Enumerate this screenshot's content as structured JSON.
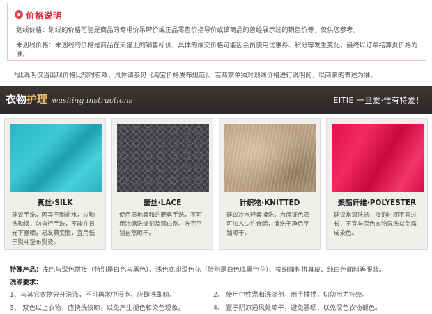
{
  "price": {
    "title": "价格说明",
    "line1_label": "划线价格：",
    "line1_text": "划线的价格可能是商品的专柜价吊牌价或正品零售价指导价或该商品的曾经展示过的销售价等，仅供您参考。",
    "line2_label": "未划线价格：",
    "line2_text": "未划线的价格是商品在天猫上的销售标价，具体的成交价格可能因会员使用优惠券、积分等发生变化，最终以订单结算页价格为准。"
  },
  "note": "*此说明仅当出现价格比较时有效，具体请参见《淘宝价格发布规范》。若商家单独对划线价格进行说明的，以商家的表述为准。",
  "banner": {
    "title_part1": "衣物",
    "title_part2": "护理",
    "subtitle": "washing instructions",
    "slogan": "EITIE 一旦爱·惟有特爱！",
    "accent_color": "#f0c060",
    "bg_color": "#2f2c2b"
  },
  "fabrics": [
    {
      "title": "真丝·SILK",
      "swatch": "teal-silk-fabric",
      "desc": "建议手洗，因其不耐盐水，应勤洗勤换，勿自行手洗，不能在日光下暴晒，易发黄变脆，宜用低于熨斗垫布熨烫。"
    },
    {
      "title": "蕾丝·LACE",
      "swatch": "black-lace-fabric",
      "desc": "使用质地柔和的肥皂手洗，不可用浓缩洗涤剂及漂白剂。洗完平铺自然晾干。"
    },
    {
      "title": "针织物·KNITTED",
      "swatch": "beige-knit-fabric",
      "desc": "建议冷水轻柔揉洗，为保证色泽可加入少许食醋，清洗干净后平铺晾干。"
    },
    {
      "title": "聚酯纤维·POLYESTER",
      "swatch": "pink-polyester-fabric",
      "desc": "建议常温洗涤，浸泡时间不宜过长，不宜与深色衣物混洗以免露成染色。"
    }
  ],
  "special": {
    "label": "特殊产品：",
    "text": "浅色与深色拼接（特别是白色与黑色）、浅色底印深色花（特别是白色底黑色花）、棉织面料拼真皮、纯白色面料等服装。"
  },
  "wash": {
    "title": "洗涤要求：",
    "items": [
      "1、与其它衣物分开洗涤，不可再水中浸泡、应即洗即晾。",
      "2、 使用中性温和洗涤剂，用手揉捏，切勿用力拧绞。",
      "3、 双色以上衣物，应快洗快晾，以免产生褪色和染色现象。",
      "4、 置于阴凉通风处晾干，避免暴晒，以免深色衣物褪色。"
    ]
  }
}
